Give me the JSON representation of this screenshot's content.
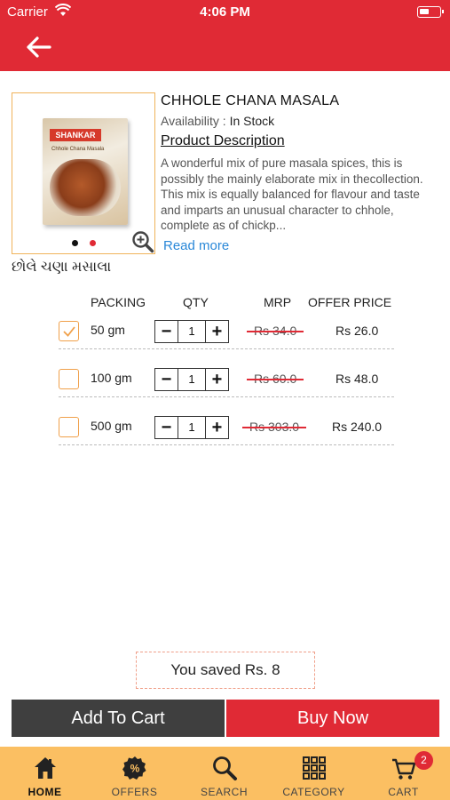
{
  "status_bar": {
    "carrier": "Carrier",
    "time": "4:06 PM"
  },
  "product": {
    "title": "CHHOLE CHANA MASALA",
    "availability_label": "Availability :",
    "availability_value": "In Stock",
    "description_heading": "Product Description",
    "description": "A wonderful mix of  pure masala spices, this is possibly the mainly elaborate mix in thecollection. This mix is equally balanced for flavour and taste and imparts an unusual character to chhole, complete as of chickp...",
    "read_more": "Read more",
    "local_name": "છોલે ચણા મસાલા",
    "image_brand": "SHANKAR",
    "image_subtitle": "Chhole Chana Masala"
  },
  "table": {
    "headers": {
      "packing": "PACKING",
      "qty": "QTY",
      "mrp": "MRP",
      "offer": "OFFER PRICE"
    },
    "rows": [
      {
        "size": "50 gm",
        "qty": "1",
        "mrp": "Rs 34.0",
        "offer": "Rs 26.0",
        "checked": true
      },
      {
        "size": "100 gm",
        "qty": "1",
        "mrp": "Rs 60.0",
        "offer": "Rs 48.0",
        "checked": false
      },
      {
        "size": "500 gm",
        "qty": "1",
        "mrp": "Rs 303.0",
        "offer": "Rs 240.0",
        "checked": false
      }
    ]
  },
  "savings": "You saved Rs. 8",
  "actions": {
    "add_to_cart": "Add To Cart",
    "buy_now": "Buy Now"
  },
  "tabs": [
    {
      "label": "HOME",
      "icon": "home-icon",
      "active": true
    },
    {
      "label": "OFFERS",
      "icon": "offers-icon",
      "active": false
    },
    {
      "label": "SEARCH",
      "icon": "search-icon",
      "active": false
    },
    {
      "label": "CATEGORY",
      "icon": "category-grid-icon",
      "active": false
    },
    {
      "label": "CART",
      "icon": "cart-icon",
      "active": false,
      "badge": "2"
    }
  ],
  "colors": {
    "primary_red": "#e02a35",
    "tab_bar": "#fbbf62",
    "add_to_cart": "#3f3f3f",
    "checkbox_orange": "#f0a04a",
    "link_blue": "#2a88d8"
  }
}
